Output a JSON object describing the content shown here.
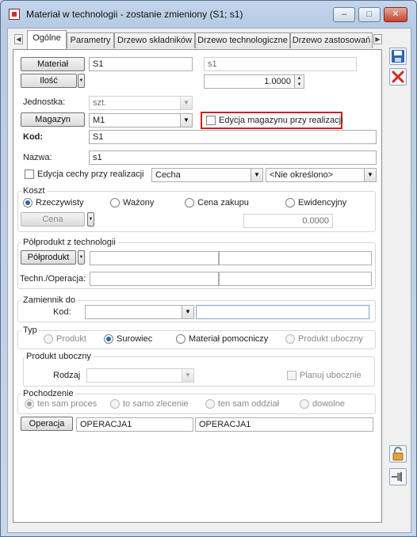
{
  "window": {
    "title": "Materiał w technologii - zostanie zmieniony  (S1; s1)",
    "minimize_icon": "minimize-icon",
    "maximize_icon": "maximize-icon",
    "close_icon": "close-icon"
  },
  "tabs": [
    {
      "label": "Ogólne",
      "active": true
    },
    {
      "label": "Parametry"
    },
    {
      "label": "Drzewo składników"
    },
    {
      "label": "Drzewo technologiczne"
    },
    {
      "label": "Drzewo zastosowań"
    }
  ],
  "material": {
    "button_label": "Materiał",
    "code_value": "S1",
    "name_value": "s1",
    "ilosc_label": "Ilość",
    "quantity_value": "1.0000",
    "jednostka_label": "Jednostka:",
    "jednostka_value": "szt.",
    "magazyn_button": "Magazyn",
    "magazyn_value": "M1",
    "edycja_magazynu_label": "Edycja magazynu przy realizacji",
    "kod_label": "Kod:",
    "kod_value": "S1",
    "nazwa_label": "Nazwa:",
    "nazwa_value": "s1",
    "edycja_cechy_label": "Edycja cechy przy realizacji",
    "cecha_value": "Cecha",
    "cecha_option_value": "<Nie określono>"
  },
  "koszt": {
    "legend": "Koszt",
    "options": [
      "Rzeczywisty",
      "Ważony",
      "Cena zakupu",
      "Ewidencyjny"
    ],
    "cena_button": "Cena",
    "cena_value": "0.0000"
  },
  "polprodukt": {
    "legend": "Półprodukt z technologii",
    "button_label": "Półprodukt",
    "techn_label": "Techn./Operacja:"
  },
  "zamiennik": {
    "legend": "Zamiennik do",
    "kod_label": "Kod:"
  },
  "typ": {
    "legend": "Typ",
    "options": [
      "Produkt",
      "Surowiec",
      "Materiał pomocniczy",
      "Produkt uboczny"
    ]
  },
  "produkt_uboczny": {
    "legend": "Produkt uboczny",
    "rodzaj_label": "Rodzaj",
    "planuj_label": "Planuj ubocznie"
  },
  "pochodzenie": {
    "legend": "Pochodzenie",
    "options": [
      "ten sam proces",
      "to samo zlecenie",
      "ten sam oddział",
      "dowolne"
    ]
  },
  "operacja": {
    "button_label": "Operacja",
    "value1": "OPERACJA1",
    "value2": "OPERACJA1"
  },
  "side_buttons": {
    "save_icon": "save-icon",
    "delete_icon": "delete-icon",
    "lock_icon": "lock-icon",
    "pin_icon": "pin-icon"
  },
  "colors": {
    "highlight": "#d11f1f",
    "selected_radio": "#2a62b4"
  }
}
